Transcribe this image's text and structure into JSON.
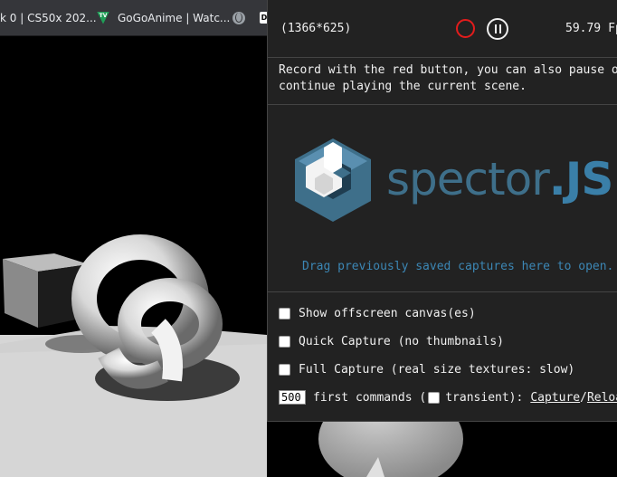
{
  "bookmarks": [
    {
      "label": "k 0 | CS50x 202..."
    },
    {
      "label": "GoGoAnime | Watc...",
      "icon": "tv-icon"
    },
    {
      "label": "",
      "icon": "globe-icon"
    },
    {
      "label": "",
      "icon": "dev-icon"
    }
  ],
  "panel": {
    "canvas_size": "(1366*625)",
    "fps_value": "59.79",
    "fps_unit": "Fp",
    "help_line1": "Record with the red button, you can also pause or",
    "help_line2": "continue playing the current scene.",
    "logo_word": "spector",
    "logo_dot": ".",
    "logo_js": "JS",
    "drag_text": "Drag previously saved captures here to open.",
    "options": {
      "offscreen": "Show offscreen canvas(es)",
      "quick": "Quick Capture (no thumbnails)",
      "full": "Full Capture (real size textures: slow)",
      "commands_value": "500",
      "commands_label": "first commands (",
      "transient": "transient):",
      "capture_link": "Capture",
      "slash": "/",
      "reload_link": "Reloa"
    }
  },
  "colors": {
    "record": "#e21c1c",
    "logo": "#3e6f8a",
    "drag": "#3c87b5",
    "panel_bg": "#222222"
  }
}
